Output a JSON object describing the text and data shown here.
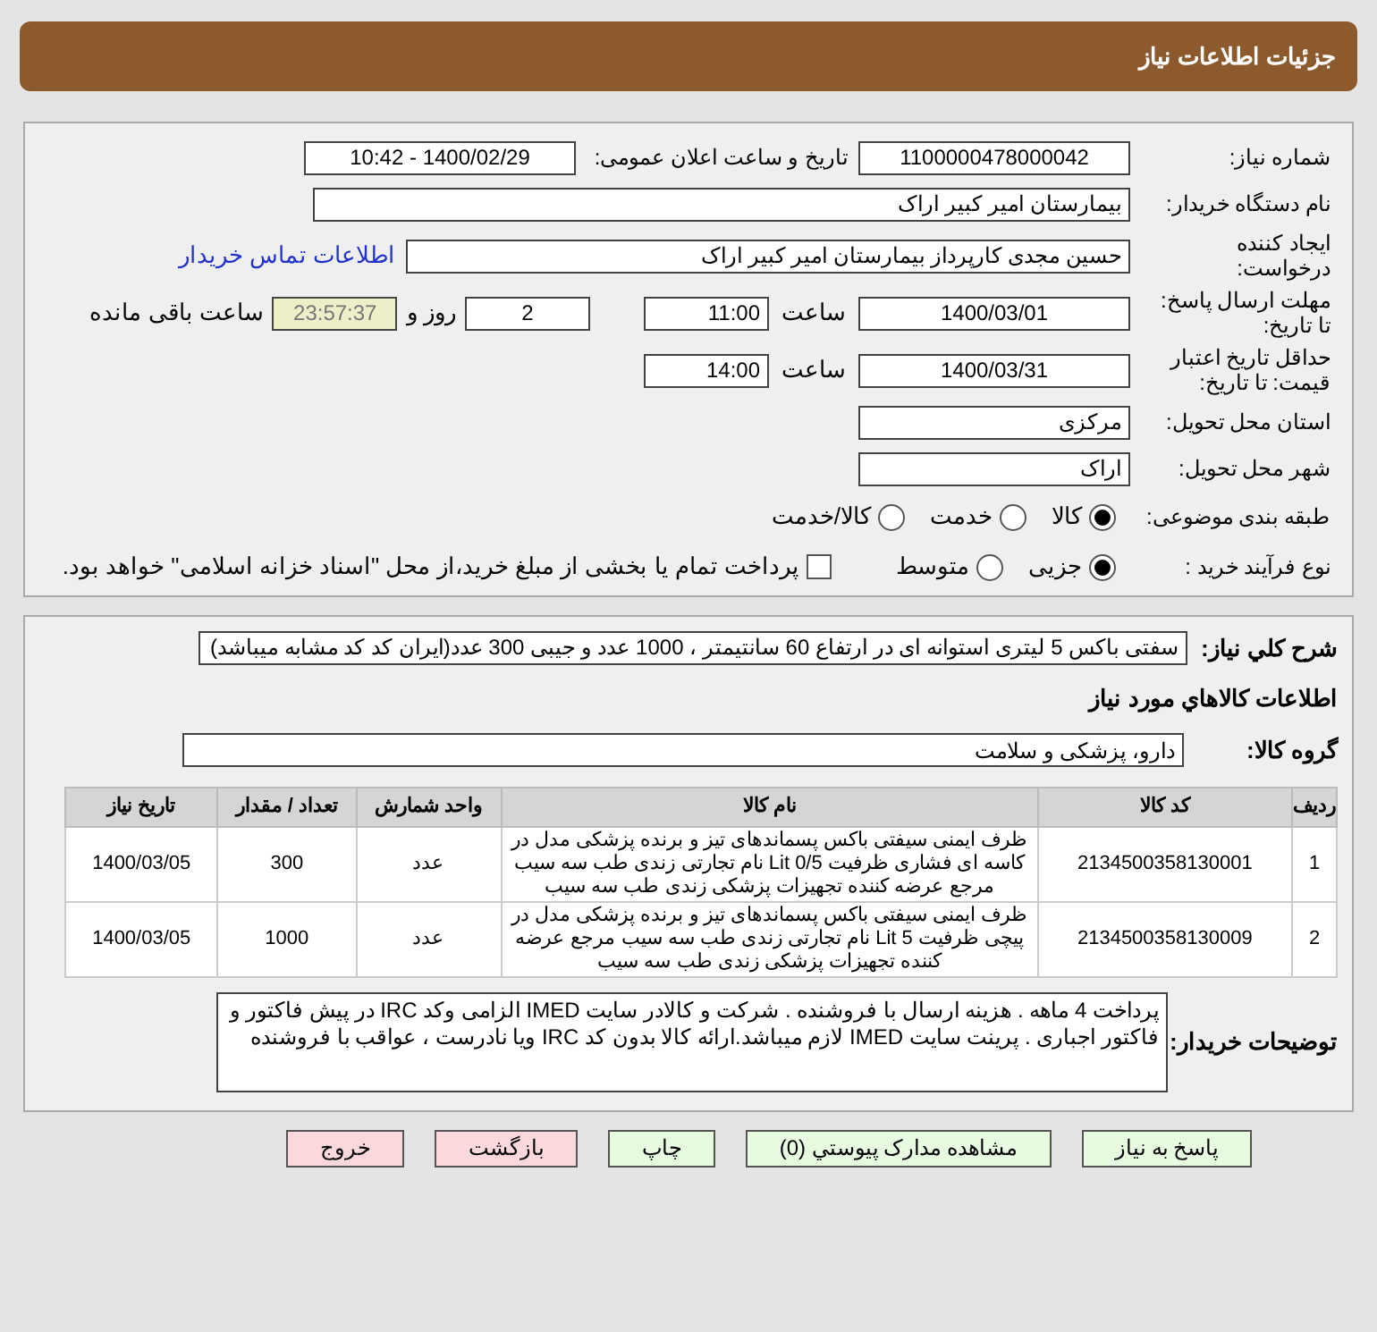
{
  "title": "جزئیات اطلاعات نیاز",
  "need_number": {
    "label": "شماره نیاز:",
    "value": "1100000478000042"
  },
  "announce": {
    "label": "تاریخ و ساعت اعلان عمومی:",
    "value": "1400/02/29 - 10:42"
  },
  "buyer": {
    "label": "نام دستگاه خریدار:",
    "value": "بیمارستان امیر کبیر اراک"
  },
  "creator": {
    "label": "ایجاد کننده درخواست:",
    "value": "حسین  مجدی کارپرداز بیمارستان امیر کبیر اراک",
    "link": "اطلاعات تماس خریدار"
  },
  "reply_deadline": {
    "label": "مهلت ارسال پاسخ: تا تاریخ:",
    "date": "1400/03/01",
    "time_label": "ساعت",
    "time": "11:00",
    "days": "2",
    "days_label": "روز و",
    "remaining": "23:57:37",
    "remaining_label": "ساعت باقی مانده"
  },
  "price_validity": {
    "label": "حداقل تاریخ اعتبار قیمت: تا تاریخ:",
    "date": "1400/03/31",
    "time_label": "ساعت",
    "time": "14:00"
  },
  "province": {
    "label": "استان محل تحویل:",
    "value": "مرکزی"
  },
  "city": {
    "label": "شهر محل تحویل:",
    "value": "اراک"
  },
  "category": {
    "label": "طبقه بندی موضوعی:",
    "options": [
      {
        "label": "کالا",
        "selected": true
      },
      {
        "label": "خدمت",
        "selected": false
      },
      {
        "label": "کالا/خدمت",
        "selected": false
      }
    ]
  },
  "process": {
    "label": "نوع فرآیند خرید :",
    "options": [
      {
        "label": "جزیی",
        "selected": true
      },
      {
        "label": "متوسط",
        "selected": false
      }
    ],
    "treasury": {
      "label": "پرداخت تمام یا بخشی از مبلغ خرید،از محل \"اسناد خزانه اسلامی\" خواهد بود.",
      "checked": false
    }
  },
  "description": {
    "label": "شرح كلي نیاز:",
    "value": "سفتی باکس 5 لیتری استوانه ای در ارتفاع 60 سانتیمتر ، 1000 عدد و جیبی 300 عدد(ایران کد کد مشابه میباشد)"
  },
  "goods_heading": "اطلاعات كالاهاي مورد نیاز",
  "goods_group": {
    "label": "گروه کالا:",
    "value": "دارو، پزشکی و سلامت"
  },
  "table": {
    "columns": [
      "ردیف",
      "کد کالا",
      "نام کالا",
      "واحد شمارش",
      "تعداد / مقدار",
      "تاریخ نیاز"
    ],
    "rows": [
      [
        "1",
        "2134500358130001",
        "ظرف ایمنی سیفتی باکس پسماندهای تیز و برنده پزشکی مدل در کاسه ای فشاری ظرفیت Lit 0/5 نام تجارتی زندی طب سه سیب مرجع عرضه کننده تجهیزات پزشکی زندی طب سه سیب",
        "عدد",
        "300",
        "1400/03/05"
      ],
      [
        "2",
        "2134500358130009",
        "ظرف ایمنی سیفتی باکس پسماندهای تیز و برنده پزشکی مدل در پیچی ظرفیت Lit 5 نام تجارتی زندی طب سه سیب مرجع عرضه کننده تجهیزات پزشکی زندی طب سه سیب",
        "عدد",
        "1000",
        "1400/03/05"
      ]
    ]
  },
  "notes": {
    "label": "توضیحات خریدار:",
    "value": "پرداخت   4 ماهه . هزینه ارسال با فروشنده . شرکت و کالادر سایت IMED الزامی وکد IRC در پیش فاکتور و فاکتور اجباری . پرینت سایت IMED لازم میباشد.ارائه کالا بدون کد IRC ویا نادرست ، عواقب با فروشنده"
  },
  "buttons": [
    {
      "label": "پاسخ به نیاز",
      "kind": "primary"
    },
    {
      "label": "مشاهده مدارک پیوستي (0)",
      "kind": "primary"
    },
    {
      "label": "چاپ",
      "kind": "primary"
    },
    {
      "label": "بازگشت",
      "kind": "danger"
    },
    {
      "label": "خروج",
      "kind": "danger"
    }
  ]
}
